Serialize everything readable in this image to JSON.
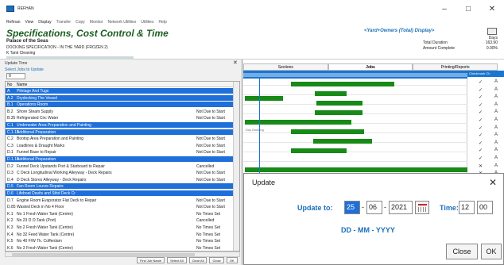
{
  "window": {
    "title": "REFHAN",
    "min": "–",
    "max": "□",
    "close": "✕"
  },
  "menu": [
    "Refman",
    "View",
    "Display",
    "Transfer",
    "Copy",
    "Monitor",
    "Network Utilities",
    "Utilities",
    "Help"
  ],
  "header": {
    "title": "Specifications, Cost Control & Time",
    "ship": "Palace of the Seas",
    "spec": "DOCKING SPECIFICATION - IN THE YARD  (FROZEN 2)",
    "task": "K Tank Cleaning",
    "owner": "<Yard+Owners (Total) Display>",
    "duration_label": "Total Duration",
    "amount_label": "Amount Complete",
    "days_label": "Days",
    "duration": "163.90",
    "amount": "0.00%"
  },
  "update_time": {
    "title": "Update Time",
    "close": "✕",
    "subtitle": "Select Jobs to Update",
    "filter": "0",
    "headers": {
      "no": "No",
      "name": "Name"
    },
    "rows": [
      {
        "no": "A",
        "name": "Pilotage And Tugs",
        "status": "",
        "sel": true
      },
      {
        "no": "A.2",
        "name": "Drydocking The Vessel",
        "status": "",
        "sel": true
      },
      {
        "no": "B.1",
        "name": "Operations Room",
        "status": "",
        "sel": true
      },
      {
        "no": "B.2",
        "name": "Shore Steam Supply",
        "status": "Not Due to Start",
        "sel": false
      },
      {
        "no": "B.35",
        "name": "Refrigerated Circ Water",
        "status": "Not Due to Start",
        "sel": false
      },
      {
        "no": "C.1",
        "name": "Underwater Area Preparation and Painting",
        "status": "",
        "sel": true
      },
      {
        "no": "C.1.15",
        "name": "Additional Preparation",
        "status": "",
        "sel": true
      },
      {
        "no": "C.2",
        "name": "Bootop Area Preparation and Painting",
        "status": "Not Due to Start",
        "sel": false
      },
      {
        "no": "C.3",
        "name": "Loadlines & Draught Marks",
        "status": "Not Due to Start",
        "sel": false
      },
      {
        "no": "D.1",
        "name": "Funnel Base to Repair",
        "status": "Not Due to Start",
        "sel": false
      },
      {
        "no": "D.1.15",
        "name": "Additional Preparation",
        "status": "",
        "sel": true
      },
      {
        "no": "D.2",
        "name": "Funnel Deck Upstands Port & Starboard to Repair",
        "status": "Cancelled",
        "sel": false
      },
      {
        "no": "D.3",
        "name": "C Deck Longitudinal Working Alleyway - Deck Repairs",
        "status": "Not Due to Start",
        "sel": false
      },
      {
        "no": "D.4",
        "name": "D Deck Stores Alleyway - Deck Repairs",
        "status": "Not Due to Start",
        "sel": false
      },
      {
        "no": "D.5",
        "name": "Fan Room Louvre Repairs",
        "status": "",
        "sel": true
      },
      {
        "no": "D.6",
        "name": "Lifeboat Davits and Stbd Deck Cr",
        "status": "",
        "sel": true
      },
      {
        "no": "D.7",
        "name": "Engine Room Evaporator Flat Deck to Repair",
        "status": "Not Due to Start",
        "sel": false
      },
      {
        "no": "D.85",
        "name": "Wasted Deck in No 4 Floor",
        "status": "Not Due to Start",
        "sel": false
      },
      {
        "no": "K.1",
        "name": "No 1 Fresh Water Tank (Centre)",
        "status": "No Times Set",
        "sel": false
      },
      {
        "no": "K.2",
        "name": "No 23 D O.Tank (Port)",
        "status": "Cancelled",
        "sel": false
      },
      {
        "no": "K.3",
        "name": "No 2 Fresh Water Tank (Centre)",
        "status": "No Times Set",
        "sel": false
      },
      {
        "no": "K.4",
        "name": "No 32 Feed Water Tank (Centre)",
        "status": "No Times Set",
        "sel": false
      },
      {
        "no": "K.5",
        "name": "No 40 F/W Tk. Cofferdam",
        "status": "No Times Set",
        "sel": false
      },
      {
        "no": "K.6",
        "name": "No 3 Fresh Water Tank (Centre)",
        "status": "No Times Set",
        "sel": false
      }
    ],
    "buttons": [
      "Find Job Name",
      "Select All",
      "Clear All",
      "Close",
      "OK"
    ]
  },
  "gantt": {
    "tabs": [
      "Sections",
      "Jobs",
      "Printing/Reports"
    ],
    "col_header": "Checkmark Ch",
    "marks": [
      "✓",
      "✓",
      "✓",
      "✓",
      "✓",
      "✓",
      "✓",
      "✓",
      "✓",
      "✓",
      "✓",
      "✕",
      "✕"
    ],
    "letters": [
      "A",
      "A",
      "A",
      "A",
      "A",
      "A",
      "A",
      "A",
      "A",
      "A",
      "A",
      "A",
      "A"
    ],
    "note": "Doy Docking"
  },
  "update": {
    "title": "Update",
    "close": "✕",
    "update_to_label": "Update to:",
    "day": "25",
    "month": "06",
    "year": "2021",
    "time_label": "Time:",
    "hour": "12",
    "minute": "00",
    "date_format": "DD - MM - YYYY",
    "close_button": "Close",
    "ok_button": "OK"
  }
}
